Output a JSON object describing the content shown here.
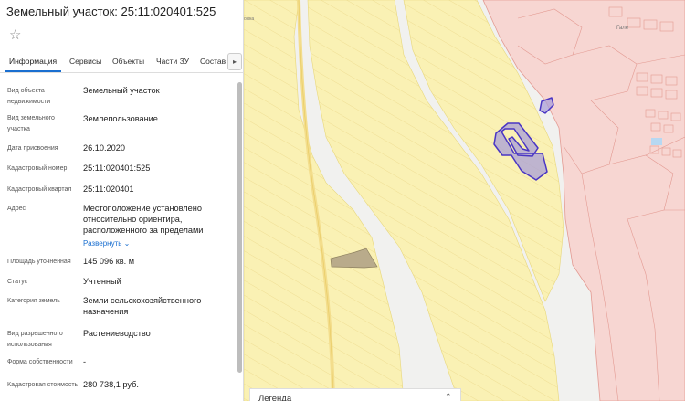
{
  "panel": {
    "title": "Земельный участок: 25:11:020401:525",
    "tabs": [
      {
        "label": "Информация",
        "active": true
      },
      {
        "label": "Сервисы",
        "active": false
      },
      {
        "label": "Объекты",
        "active": false
      },
      {
        "label": "Части ЗУ",
        "active": false
      },
      {
        "label": "Состав",
        "active": false
      }
    ],
    "tabs_next_icon": "chevron-right-icon",
    "favorite_icon": "star-icon",
    "rows": [
      {
        "label": "Вид объекта недвижимости",
        "value": "Земельный участок"
      },
      {
        "label": "Вид земельного участка",
        "value": "Землепользование"
      },
      {
        "label": "Дата присвоения",
        "value": "26.10.2020"
      },
      {
        "label": "Кадастровый номер",
        "value": "25:11:020401:525"
      },
      {
        "label": "Кадастровый квартал",
        "value": "25:11:020401"
      },
      {
        "label": "Адрес",
        "value": "Местоположение установлено относительно ориентира, расположенного за пределами",
        "link": "Развернуть"
      },
      {
        "label": "Площадь уточненная",
        "value": "145 096 кв. м"
      },
      {
        "label": "Статус",
        "value": "Учтенный"
      },
      {
        "label": "Категория земель",
        "value": "Земли сельскохозяйственного назначения"
      },
      {
        "label": "Вид разрешенного использования",
        "value": "Растениеводство"
      },
      {
        "label": "Форма собственности",
        "value": "-"
      },
      {
        "label": "Кадастровая стоимость",
        "value": "280 738,1 руб."
      }
    ]
  },
  "map": {
    "road_label": "ожка",
    "town_label": "Гале",
    "legend_label": "Легенда",
    "legend_toggle_icon": "chevron-up-icon",
    "colors": {
      "background": "#f1f1ef",
      "agri_land": "#faf1b4",
      "agri_stroke": "#e8d77a",
      "settlement": "#f7d6d2",
      "settlement_stroke": "#e39a92",
      "selected_parcel": "#a99fd8",
      "selected_stroke": "#4a36c4",
      "other_parcel": "#b9ab8b",
      "road": "#f3dd8c",
      "water": "#b7d8f2"
    }
  }
}
